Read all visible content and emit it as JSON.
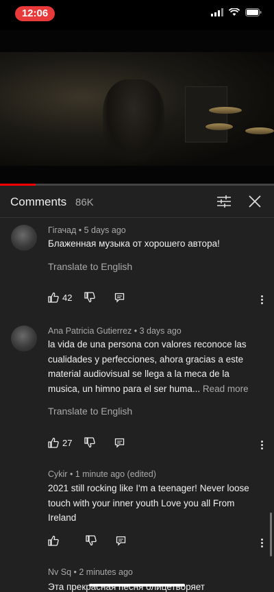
{
  "status_bar": {
    "time": "12:06"
  },
  "video": {
    "progress_fraction": 0.13
  },
  "comments_header": {
    "title": "Comments",
    "count": "86K"
  },
  "comments": [
    {
      "author_meta": "Гігачад • 5 days ago",
      "text": "Блаженная музыка от хорошего автора!",
      "translate": "Translate to English",
      "likes": "42"
    },
    {
      "author_meta": "Ana Patricia Gutierrez • 3 days ago",
      "text": "la vida de una persona con valores reconoce las cualidades y perfecciones, ahora gracias a este material audiovisual se llega a la meca de la musica, un himno para el ser huma...",
      "read_more": "Read more",
      "translate": "Translate to English",
      "likes": "27"
    },
    {
      "author_meta": "Cykir • 1 minute ago (edited)",
      "text": "2021 still rocking like I'm a teenager! Never loose touch with your inner youth   Love you all From Ireland",
      "likes": ""
    },
    {
      "author_meta": "Nv Sq • 2 minutes ago",
      "text": "Эта прекрасная песня олицетворяет"
    }
  ]
}
